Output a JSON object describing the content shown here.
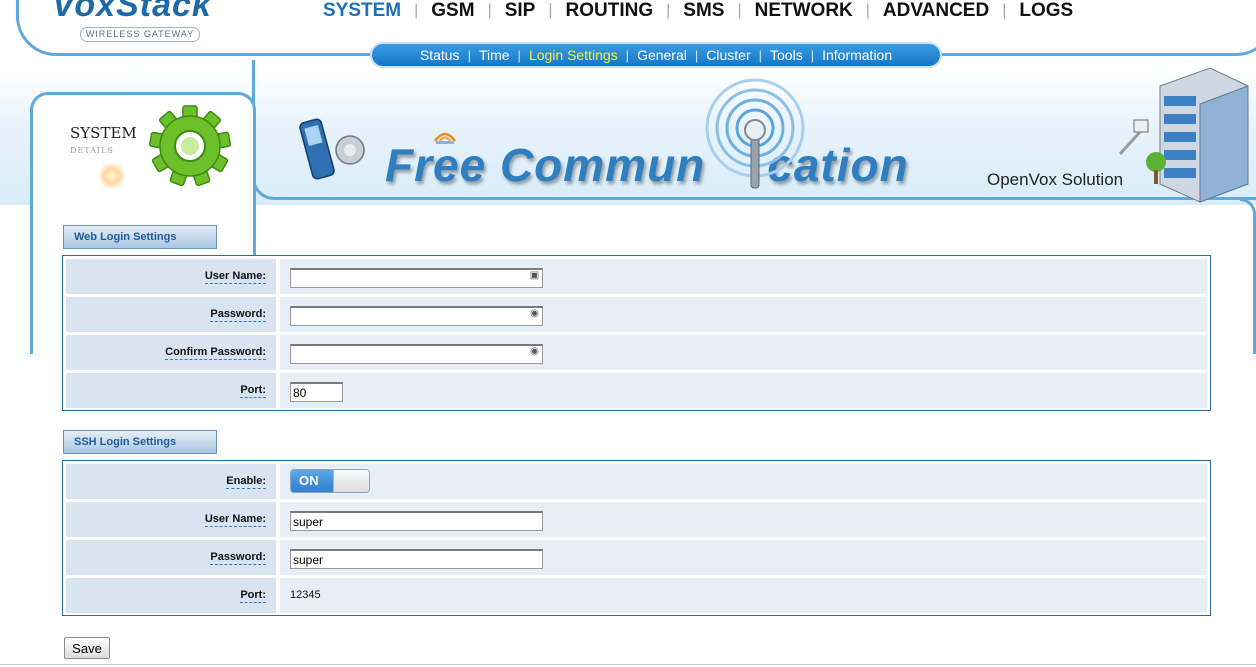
{
  "brand": {
    "logo": "VoxStack",
    "subtitle": "WIRELESS GATEWAY"
  },
  "main_nav": [
    {
      "label": "SYSTEM",
      "active": true
    },
    {
      "label": "GSM"
    },
    {
      "label": "SIP"
    },
    {
      "label": "ROUTING"
    },
    {
      "label": "SMS"
    },
    {
      "label": "NETWORK"
    },
    {
      "label": "ADVANCED"
    },
    {
      "label": "LOGS"
    }
  ],
  "sub_nav": [
    {
      "label": "Status"
    },
    {
      "label": "Time"
    },
    {
      "label": "Login Settings",
      "active": true
    },
    {
      "label": "General"
    },
    {
      "label": "Cluster"
    },
    {
      "label": "Tools"
    },
    {
      "label": "Information"
    }
  ],
  "banner": {
    "section_title": "SYSTEM",
    "section_sub": "DETAILS",
    "tagline_a": "Free Commun",
    "tagline_b": "cation",
    "vendor": "OpenVox Solution"
  },
  "web_login": {
    "heading": "Web Login Settings",
    "user_name_label": "User Name:",
    "user_name_value": "",
    "password_label": "Password:",
    "password_value": "",
    "confirm_label": "Confirm Password:",
    "confirm_value": "",
    "port_label": "Port:",
    "port_value": "80"
  },
  "ssh_login": {
    "heading": "SSH Login Settings",
    "enable_label": "Enable:",
    "enable_state": "ON",
    "user_name_label": "User Name:",
    "user_name_value": "super",
    "password_label": "Password:",
    "password_value": "super",
    "port_label": "Port:",
    "port_value": "12345"
  },
  "actions": {
    "save_label": "Save"
  },
  "colors": {
    "accent_blue": "#1f6fb4",
    "frame_blue": "#5fa9dc",
    "active_sub": "#f7f13a",
    "label_bg": "#d8e4f0",
    "value_bg": "#e7eef6"
  }
}
